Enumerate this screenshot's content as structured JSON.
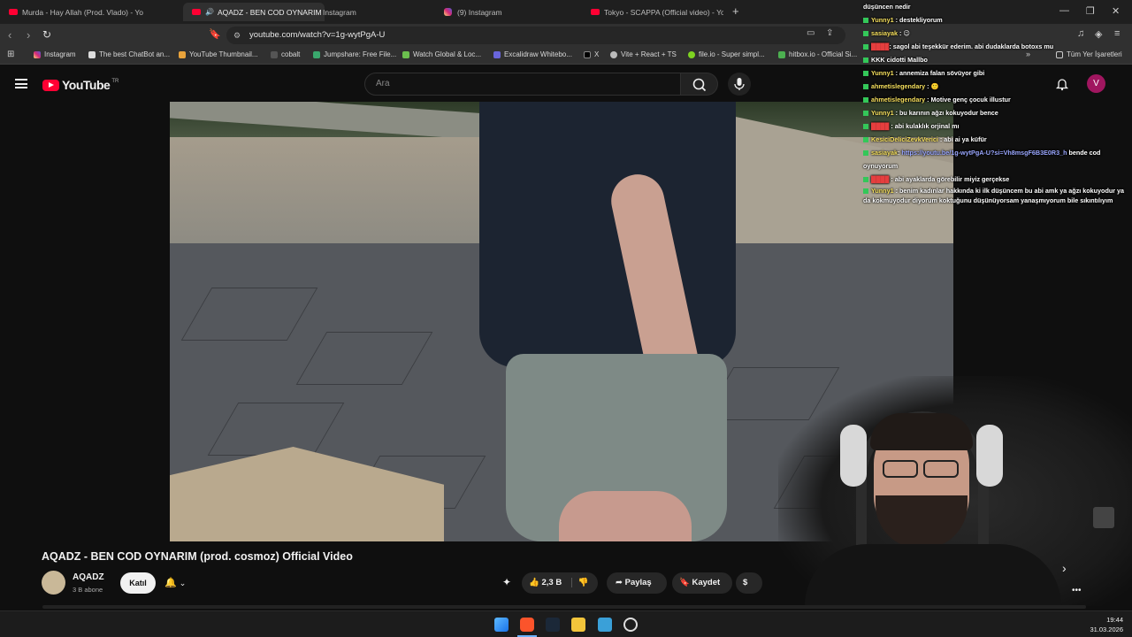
{
  "browser": {
    "tabs": [
      {
        "title": "Murda - Hay Allah (Prod. Vlado) - Yo",
        "icon": "youtube-icon"
      },
      {
        "title": "AQADZ - BEN COD OYNARIM",
        "icon": "youtube-icon",
        "active": true
      },
      {
        "title": "Instagram",
        "icon": "instagram-icon"
      },
      {
        "title": "(9) Instagram",
        "icon": "instagram-icon"
      },
      {
        "title": "Tokyo - SCAPPA (Official video) - You",
        "icon": "youtube-icon"
      }
    ],
    "url": "youtube.com/watch?v=1g-wytPgA-U",
    "bookmarks": [
      "Instagram",
      "The best ChatBot an...",
      "YouTube Thumbnail...",
      "cobalt",
      "Jumpshare: Free File...",
      "Watch Global & Loc...",
      "Excalidraw Whitebo...",
      "X",
      "Vite + React + TS",
      "file.io - Super simpl...",
      "hitbox.io - Official Si..."
    ],
    "bookmarks_other": "Tüm Yer İşaretleri"
  },
  "youtube": {
    "logo_text": "YouTube",
    "country": "TR",
    "search_placeholder": "Ara",
    "user_initial": "V"
  },
  "video": {
    "title": "AQADZ - BEN COD OYNARIM (prod. cosmoz) Official Video",
    "channel": "AQADZ",
    "subscribers": "3 B abone",
    "join_label": "Katıl",
    "likes": "2,3 B",
    "share_label": "Paylaş",
    "save_label": "Kaydet"
  },
  "chat": [
    {
      "user": "",
      "text": "düşüncen nedir"
    },
    {
      "user": "Yunny1",
      "text": ": destekliyorum"
    },
    {
      "user": "sasiayak",
      "text": ": 😉"
    },
    {
      "user": "",
      "text": ": sagol abi teşekkür ederim. abi dudaklarda botoxs mu"
    },
    {
      "user": "",
      "text": "KKK cidotti Mallbo"
    },
    {
      "user": "Yunny1",
      "text": ": annemiza falan sövüyor gibi"
    },
    {
      "user": "ahmetislegendary",
      "text": ": 🙂"
    },
    {
      "user": "ahmetislegendary",
      "text": ": Motive genç çocuk illustur"
    },
    {
      "user": "Yunny1",
      "text": ": bu karının ağzı kokuyodur bence"
    },
    {
      "user": "",
      "text": ": abi kulaklık orjinal mı"
    },
    {
      "user": "KesiciDeliciZevkVerici",
      "text": ": abi ai ya küfür"
    },
    {
      "user": "sasiayak",
      "text": ": ",
      "link": "https://youtu.be/1g-wytPgA-U?si=Vh8msgF6B3E0R3_h",
      "after": " bende cod oynuyorum"
    },
    {
      "user": "",
      "text": ": abi ayaklarda görebilir miyiz gerçekse"
    },
    {
      "user": "Yunny1",
      "text": ": benim kadınlar hakkında ki ilk düşüncem bu abi amk ya ağzı kokuyodur ya da kokmuyodur diyorum koktuğunu düşünüyorsam yanaşmıyorum bile sıkıntılıyım"
    }
  ],
  "taskbar": {
    "time": "19:44",
    "date": "31.03.2026"
  }
}
